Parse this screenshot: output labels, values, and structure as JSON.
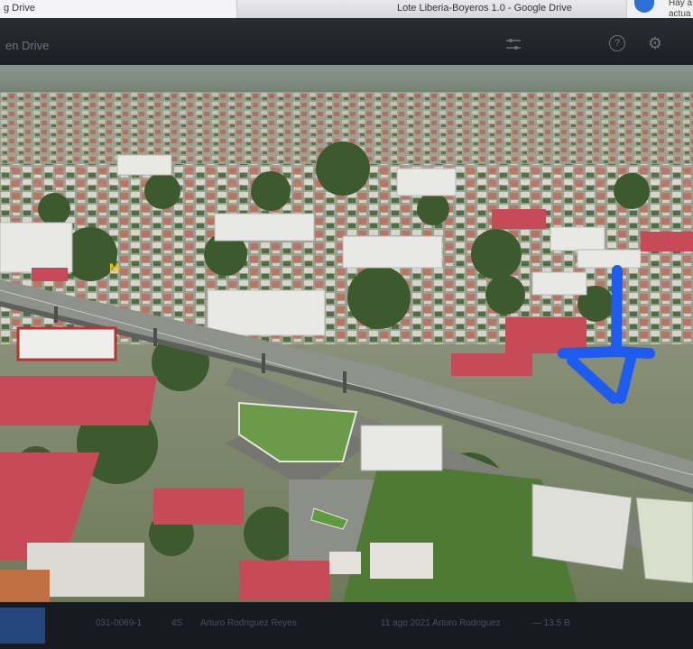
{
  "browser": {
    "left_tab": "g Drive",
    "window_title": "Lote Liberia-Boyeros 1.0 - Google Drive",
    "notification": {
      "line1": "Hay a",
      "line2": "actua"
    }
  },
  "drive_header": {
    "title": "en Drive",
    "filter_icon": "filter-sliders-icon",
    "help_icon": "help-circle-icon",
    "settings_icon": "gear-icon"
  },
  "image_viewer": {
    "image_alt": "Aerial photo"
  },
  "details_bar": {
    "file_id": "031-0069-1",
    "col1": "4S",
    "owner": "Arturo Rodriguez Reyes",
    "date": "11 ago 2021 Arturo Rodriguez",
    "size": "— 13.5 B"
  },
  "colors": {
    "header_bg": "#1c1f24",
    "arrow_blue": "#1e5cf0",
    "pink_roof": "#c64a58"
  }
}
